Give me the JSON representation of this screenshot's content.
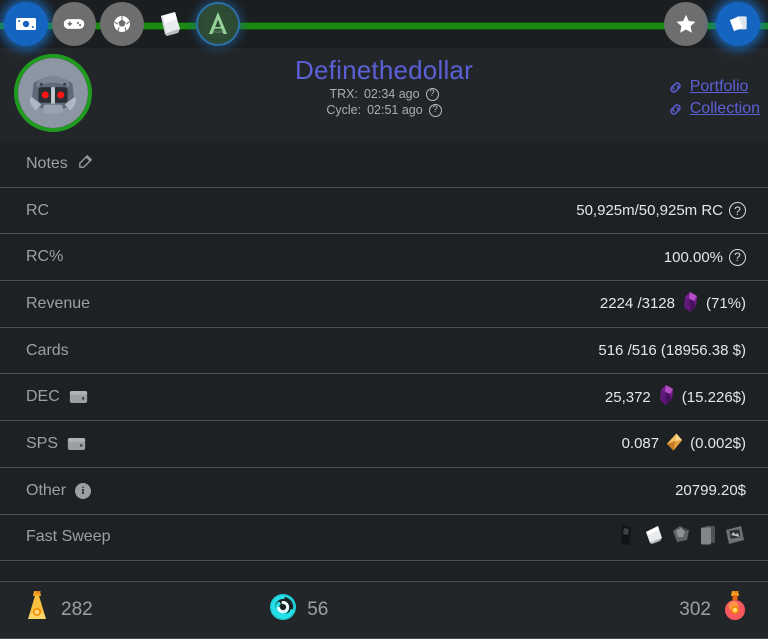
{
  "nav": {
    "left_items": [
      {
        "name": "cash-icon",
        "label": "Cash",
        "state": "active"
      },
      {
        "name": "gamepad-icon",
        "label": "Battle",
        "state": "default"
      },
      {
        "name": "shield-icon",
        "label": "Guild",
        "state": "default"
      },
      {
        "name": "cards-icon",
        "label": "Packs",
        "state": "plain"
      },
      {
        "name": "arcane-icon",
        "label": "Arcane",
        "state": "ringed"
      }
    ],
    "right_items": [
      {
        "name": "star-icon",
        "label": "Favorites",
        "state": "default"
      },
      {
        "name": "card-stack-icon",
        "label": "Collection",
        "state": "active"
      }
    ],
    "accent_green": "#1d8a15"
  },
  "header": {
    "username": "Definethedollar",
    "avatar_name": "robot-avatar",
    "avatar_border_color": "#1f9c1f",
    "title_color": "#5b60d6",
    "trx_label": "TRX:",
    "trx_value": "02:34 ago",
    "cycle_label": "Cycle:",
    "cycle_value": "02:51 ago",
    "help_glyph": "?",
    "links": [
      {
        "label": "Portfolio",
        "icon": "link-chain-icon"
      },
      {
        "label": "Collection",
        "icon": "link-chain-icon"
      }
    ]
  },
  "rows": [
    {
      "id": "notes",
      "label": "Notes",
      "label_icon": "edit-pencil-icon",
      "value": ""
    },
    {
      "id": "rc",
      "label": "RC",
      "value": "50,925m/50,925m RC",
      "value_icon": "help-circle-icon"
    },
    {
      "id": "rc-percent",
      "label": "RC%",
      "value": "100.00%",
      "value_icon": "help-circle-icon"
    },
    {
      "id": "revenue",
      "label": "Revenue",
      "value": "2224 /3128",
      "value_icon": "dec-gem-icon",
      "value_suffix": "(71%)"
    },
    {
      "id": "cards",
      "label": "Cards",
      "value": "516 /516 (18956.38 $)"
    },
    {
      "id": "dec",
      "label": "DEC",
      "label_icon": "wallet-icon",
      "value": "25,372",
      "value_icon": "dec-gem-icon",
      "value_suffix": "(15.226$)"
    },
    {
      "id": "sps",
      "label": "SPS",
      "label_icon": "wallet-icon",
      "value": "0.087",
      "value_icon": "sps-crystal-icon",
      "value_suffix": "(0.002$)"
    },
    {
      "id": "other",
      "label": "Other",
      "label_icon": "info-circle-icon",
      "value": "20799.20$"
    },
    {
      "id": "fast-sweep",
      "label": "Fast Sweep",
      "sweep_icons": [
        "chaos-legion-pack-icon",
        "white-paper-pack-icon",
        "crumpled-pack-icon",
        "card-back-icon",
        "framed-card-icon"
      ]
    }
  ],
  "bottom": {
    "items": [
      {
        "id": "legendary-potion",
        "icon": "gold-potion-icon",
        "value": "282",
        "position": "left"
      },
      {
        "id": "energy-swirl",
        "icon": "teal-spiral-icon",
        "value": "56",
        "position": "mid"
      },
      {
        "id": "alchemy-potion",
        "icon": "red-potion-icon",
        "value": "302",
        "position": "right"
      }
    ]
  }
}
